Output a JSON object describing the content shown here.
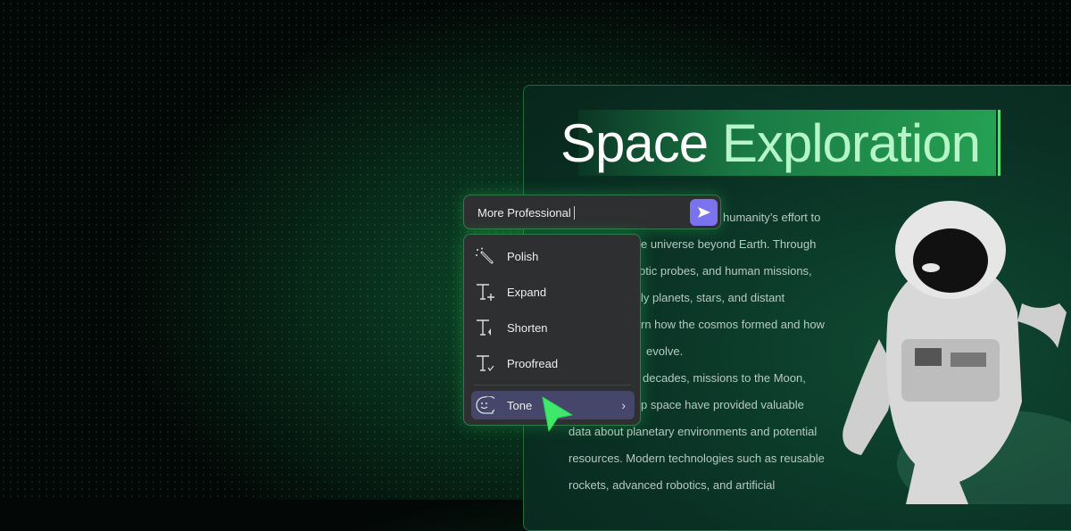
{
  "document": {
    "title_plain": "Space",
    "title_selected": "Exploration",
    "body_fragments": [
      "humanity’s effort to",
      "e universe beyond Earth. Through",
      "otic probes, and human missions,",
      "ly planets, stars, and distant",
      "rn how the cosmos formed and how",
      "evolve.",
      "decades, missions to the Moon,",
      "p space have provided valuable",
      "data about planetary environments and potential",
      "resources. Modern technologies such as reusable",
      "rockets, advanced robotics, and artificial"
    ]
  },
  "prompt": {
    "value": "More Professional",
    "send_icon": "send-icon"
  },
  "menu": {
    "items": [
      {
        "label": "Polish",
        "icon": "magic-wand-icon"
      },
      {
        "label": "Expand",
        "icon": "text-expand-icon"
      },
      {
        "label": "Shorten",
        "icon": "text-shorten-icon"
      },
      {
        "label": "Proofread",
        "icon": "text-proofread-icon"
      },
      {
        "label": "Tone",
        "icon": "smiley-chat-icon",
        "submenu": true
      }
    ]
  },
  "colors": {
    "accent": "#7b72f0",
    "highlight": "#25a052",
    "cursor": "#3ee86a"
  }
}
